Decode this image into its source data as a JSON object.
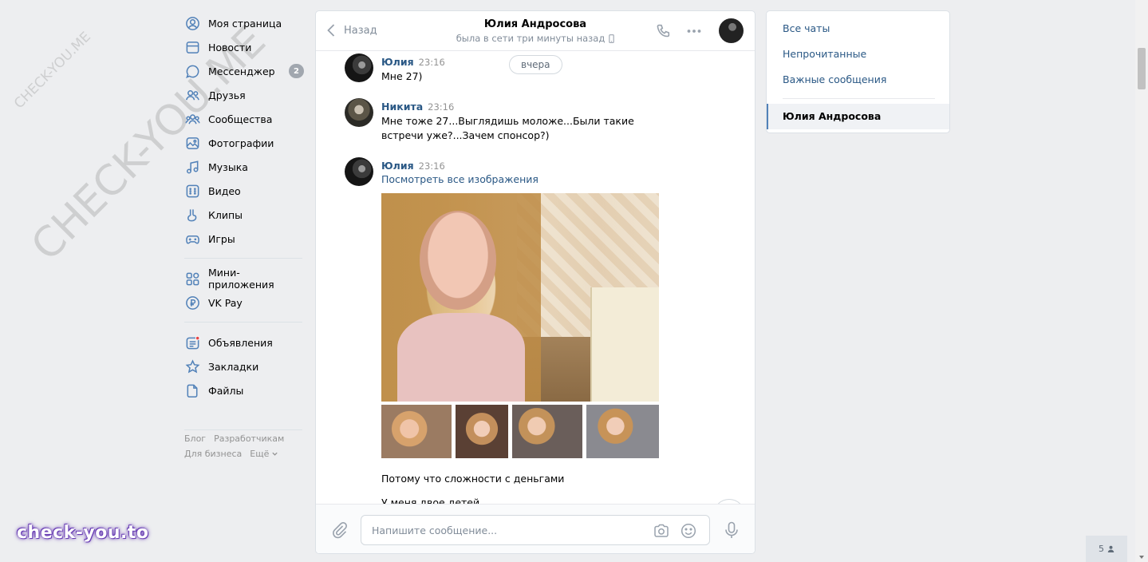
{
  "nav": {
    "items": [
      {
        "label": "Моя страница",
        "icon": "user-circle-icon"
      },
      {
        "label": "Новости",
        "icon": "news-icon"
      },
      {
        "label": "Мессенджер",
        "icon": "messenger-icon",
        "badge": "2"
      },
      {
        "label": "Друзья",
        "icon": "friends-icon"
      },
      {
        "label": "Сообщества",
        "icon": "communities-icon"
      },
      {
        "label": "Фотографии",
        "icon": "photos-icon"
      },
      {
        "label": "Музыка",
        "icon": "music-icon"
      },
      {
        "label": "Видео",
        "icon": "video-icon"
      },
      {
        "label": "Клипы",
        "icon": "clips-icon"
      },
      {
        "label": "Игры",
        "icon": "games-icon"
      }
    ],
    "apps": [
      {
        "label": "Мини-приложения",
        "icon": "apps-icon"
      },
      {
        "label": "VK Pay",
        "icon": "vkpay-icon"
      }
    ],
    "extra": [
      {
        "label": "Объявления",
        "icon": "ads-icon"
      },
      {
        "label": "Закладки",
        "icon": "bookmark-star-icon"
      },
      {
        "label": "Файлы",
        "icon": "files-icon"
      }
    ],
    "footer": {
      "blog": "Блог",
      "developers": "Разработчикам",
      "business": "Для бизнеса",
      "more": "Ещё"
    }
  },
  "chat": {
    "back_label": "Назад",
    "peer_name": "Юлия Андросова",
    "peer_status": "была в сети три минуты назад",
    "date_pill": "вчера",
    "messages": [
      {
        "author": "Юлия",
        "time": "23:16",
        "text": "Мне 27)"
      },
      {
        "author": "Никита",
        "time": "23:16",
        "text": "Мне тоже 27...Выглядишь моложе...Были такие встречи уже?...Зачем спонсор?)"
      },
      {
        "author": "Юлия",
        "time": "23:16",
        "link": "Посмотреть все изображения"
      }
    ],
    "after_album": [
      "Потому что сложности с деньгами",
      "У меня двое детей"
    ],
    "composer_placeholder": "Напишите сообщение..."
  },
  "folders": {
    "items": [
      "Все чаты",
      "Непрочитанные",
      "Важные сообщения"
    ],
    "active": "Юлия Андросова"
  },
  "counter": "5",
  "watermarks": {
    "small": "CHECK-YOU.ME",
    "big": "CHECK-YOU.ME",
    "brand": "check-you.to"
  },
  "colors": {
    "link": "#2a5885",
    "accent": "#5181b8",
    "background": "#edeef0"
  }
}
